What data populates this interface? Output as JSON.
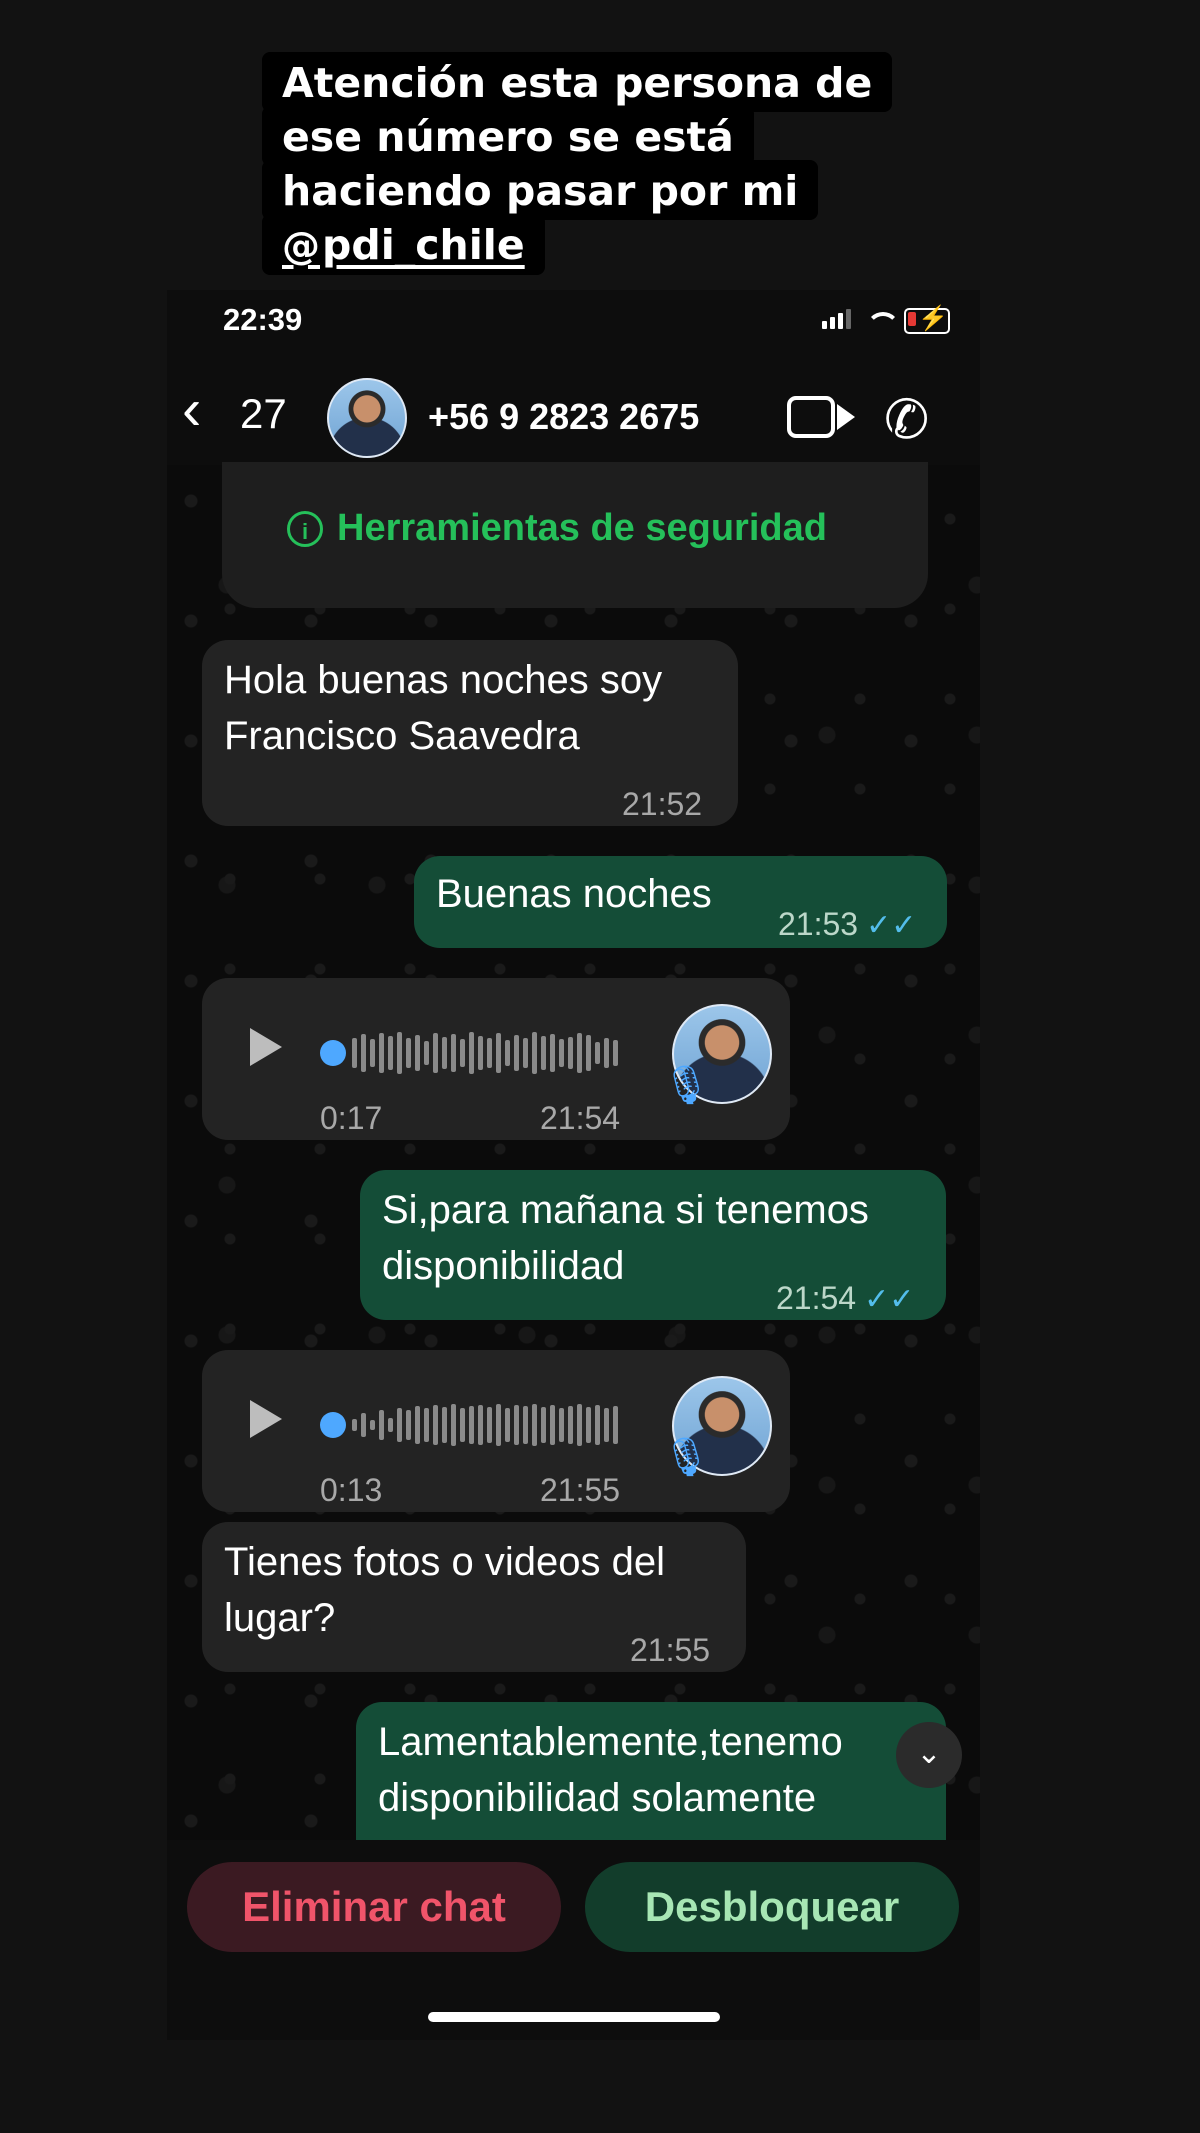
{
  "caption": {
    "lines": [
      "Atención esta persona de",
      "ese número se está",
      "haciendo pasar por mi"
    ],
    "mention_glyph": "@",
    "mention": "pdi_chile"
  },
  "status_bar": {
    "time": "22:39",
    "battery_color": "#e53935"
  },
  "header": {
    "back_icon": "‹",
    "back_count": "27",
    "contact": "+56 9 2823 2675",
    "video_icon": "video-camera-icon",
    "call_icon": "phone-icon"
  },
  "security": {
    "label": "Herramientas de seguridad",
    "color": "#25c05a"
  },
  "messages": [
    {
      "type": "text",
      "direction": "in",
      "lines": [
        "Hola buenas noches soy",
        "Francisco Saavedra"
      ],
      "time": "21:52"
    },
    {
      "type": "text",
      "direction": "out",
      "lines": [
        "Buenas noches"
      ],
      "time": "21:53",
      "ticks": "✓✓"
    },
    {
      "type": "audio",
      "direction": "in",
      "duration": "0:17",
      "time": "21:54"
    },
    {
      "type": "text",
      "direction": "out",
      "lines": [
        "Si,para mañana si tenemos",
        "disponibilidad"
      ],
      "time": "21:54",
      "ticks": "✓✓"
    },
    {
      "type": "audio",
      "direction": "in",
      "duration": "0:13",
      "time": "21:55"
    },
    {
      "type": "text",
      "direction": "in",
      "lines": [
        "Tienes fotos o videos del",
        "lugar?"
      ],
      "time": "21:55"
    },
    {
      "type": "text",
      "direction": "out",
      "lines": [
        "Lamentablemente,tenemo",
        "disponibilidad solamente"
      ]
    }
  ],
  "actions": {
    "delete": "Eliminar chat",
    "unblock": "Desbloquear"
  },
  "colors": {
    "incoming": "#232323",
    "outgoing": "#144d37",
    "accent_blue": "#53bdeb"
  }
}
